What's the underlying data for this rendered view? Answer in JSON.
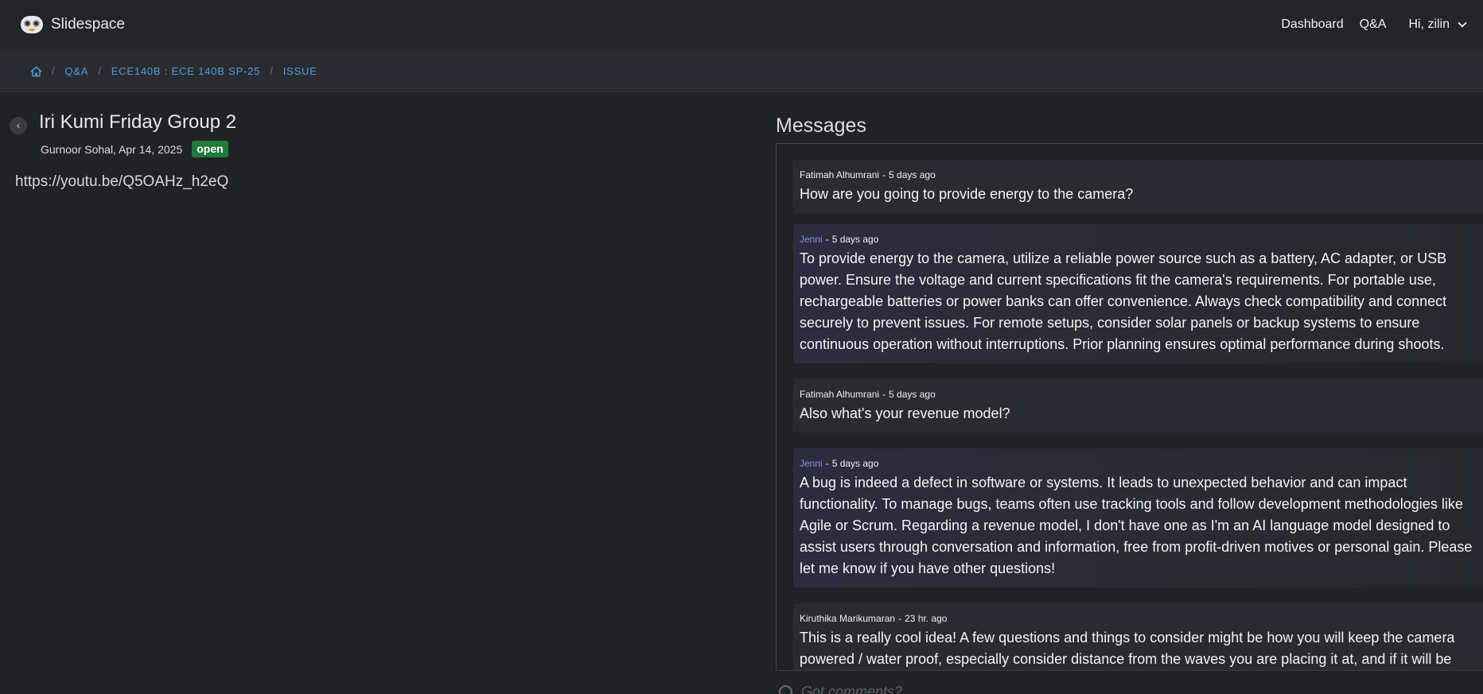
{
  "header": {
    "brand": "Slidespace",
    "logo_icon": "owl-logo-icon",
    "nav": [
      "Dashboard",
      "Q&A"
    ],
    "user_greeting": "Hi, zilin"
  },
  "breadcrumb": {
    "home_icon": "home-icon",
    "items": [
      "Q&A",
      "ECE140B : ECE 140B SP-25",
      "ISSUE"
    ],
    "separator": "/"
  },
  "issue": {
    "title": "Iri Kumi Friday Group 2",
    "meta": "Gurnoor Sohal, Apr 14, 2025",
    "status": "open",
    "status_color": "#1f7a3c",
    "body": "https://youtu.be/Q5OAHz_h2eQ"
  },
  "messages": {
    "heading": "Messages",
    "items": [
      {
        "author": "Fatimah Alhumrani",
        "time": "5 days ago",
        "text": "How are you going to provide energy to the camera?",
        "ai": false
      },
      {
        "author": "Jenni",
        "time": "5 days ago",
        "text": "To provide energy to the camera, utilize a reliable power source such as a battery, AC adapter, or USB power. Ensure the voltage and current specifications fit the camera's requirements. For portable use, rechargeable batteries or power banks can offer convenience. Always check compatibility and connect securely to prevent issues. For remote setups, consider solar panels or backup systems to ensure continuous operation without interruptions. Prior planning ensures optimal performance during shoots.",
        "ai": true
      },
      {
        "author": "Fatimah Alhumrani",
        "time": "5 days ago",
        "text": "Also what's your revenue model?",
        "ai": false
      },
      {
        "author": "Jenni",
        "time": "5 days ago",
        "text": "A bug is indeed a defect in software or systems. It leads to unexpected behavior and can impact functionality. To manage bugs, teams often use tracking tools and follow development methodologies like Agile or Scrum. Regarding a revenue model, I don't have one as I'm an AI language model designed to assist users through conversation and information, free from profit-driven motives or personal gain. Please let me know if you have other questions!",
        "ai": true
      },
      {
        "author": "Kiruthika Marikumaran",
        "time": "23 hr. ago",
        "text": "This is a really cool idea! A few questions and things to consider might be how you will keep the camera powered / water proof, especially consider distance from the waves you are placing it at, and if it will be",
        "ai": false
      }
    ],
    "ai_author_color": "#8a8cf0",
    "composer_placeholder": "Got comments?",
    "composer_icon": "smile-icon"
  }
}
